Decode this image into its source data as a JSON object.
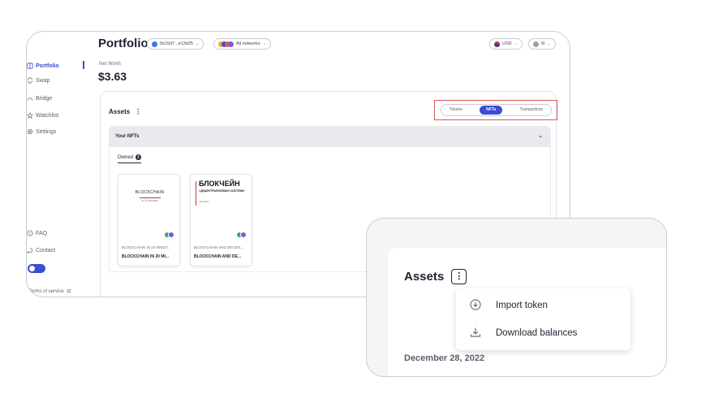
{
  "sidebar": {
    "items": [
      {
        "label": "Portfolio"
      },
      {
        "label": "Swap"
      },
      {
        "label": "Bridge"
      },
      {
        "label": "Watchlist"
      },
      {
        "label": "Settings"
      }
    ],
    "bottom": [
      {
        "label": "FAQ"
      },
      {
        "label": "Contact"
      }
    ],
    "terms": "Terms of service"
  },
  "header": {
    "title": "Portfolio",
    "account": "0x15d7...e13d25",
    "network": "All networks",
    "currency": "USD",
    "user": "6I"
  },
  "net_worth": {
    "label": "Net Worth",
    "value": "$3.63"
  },
  "assets": {
    "label": "Assets",
    "tabs": [
      {
        "label": "Tokens"
      },
      {
        "label": "NFTs"
      },
      {
        "label": "Transactions"
      }
    ],
    "selected_tab": "NFTs",
    "section_title": "Your NFTs",
    "owned_label": "Owned",
    "owned_count": "2",
    "nfts": [
      {
        "collection": "BLOCKCHAIN IN 20 MINUT...",
        "name": "BLOCKCHAIN IN 20 MI...",
        "cover_title": "BLOCKCHAIN",
        "cover_sub": "in 20 minutes"
      },
      {
        "collection": "BLOCKCHAIN AND DECEN...",
        "name": "BLOCKCHAIN AND DE...",
        "cover_title": "БЛОКЧЕЙН",
        "cover_sub": "І ДЕЦЕНТРАЛІЗОВАНІ СИСТЕМИ",
        "cover_part": "частина I"
      }
    ]
  },
  "zoom": {
    "assets_label": "Assets",
    "menu": [
      {
        "label": "Import token"
      },
      {
        "label": "Download balances"
      }
    ],
    "date": "December 28, 2022"
  },
  "colors": {
    "accent": "#3a4dd6",
    "highlight_border": "#e05555"
  }
}
